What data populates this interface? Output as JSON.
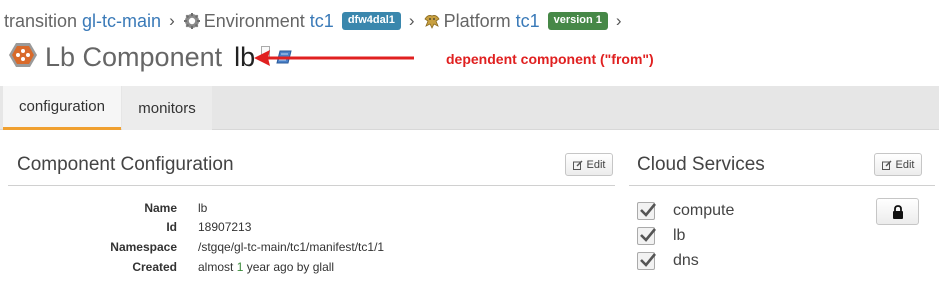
{
  "breadcrumb": {
    "assembly_prefix": "transition",
    "assembly_name": "gl-tc-main",
    "environment_prefix": "Environment",
    "environment_name": "tc1",
    "environment_badge": "dfw4dal1",
    "platform_prefix": "Platform",
    "platform_name": "tc1",
    "platform_badge": "version 1"
  },
  "title": {
    "component_type": "Lb Component",
    "component_name": "lb"
  },
  "annotation": {
    "text": "dependent component (\"from\")",
    "color": "#e02020"
  },
  "tabs": [
    {
      "label": "configuration",
      "active": true
    },
    {
      "label": "monitors",
      "active": false
    }
  ],
  "config_panel": {
    "title": "Component Configuration",
    "edit_label": "Edit",
    "rows": [
      {
        "label": "Name",
        "value": "lb"
      },
      {
        "label": "Id",
        "value": "18907213"
      },
      {
        "label": "Namespace",
        "value": "/stgqe/gl-tc-main/tc1/manifest/tc1/1"
      },
      {
        "label": "Created",
        "value_pre": "almost ",
        "value_highlight": "1",
        "value_post": " year ago by glall"
      }
    ]
  },
  "cloud_panel": {
    "title": "Cloud Services",
    "edit_label": "Edit",
    "services": [
      {
        "label": "compute",
        "checked": true
      },
      {
        "label": "lb",
        "checked": true
      },
      {
        "label": "dns",
        "checked": true
      }
    ],
    "lock_icon": "lock-icon"
  },
  "colors": {
    "link": "#3a7ab8",
    "badge_blue": "#3a87ad",
    "badge_green": "#468847",
    "active_tab_accent": "#f0a030"
  }
}
